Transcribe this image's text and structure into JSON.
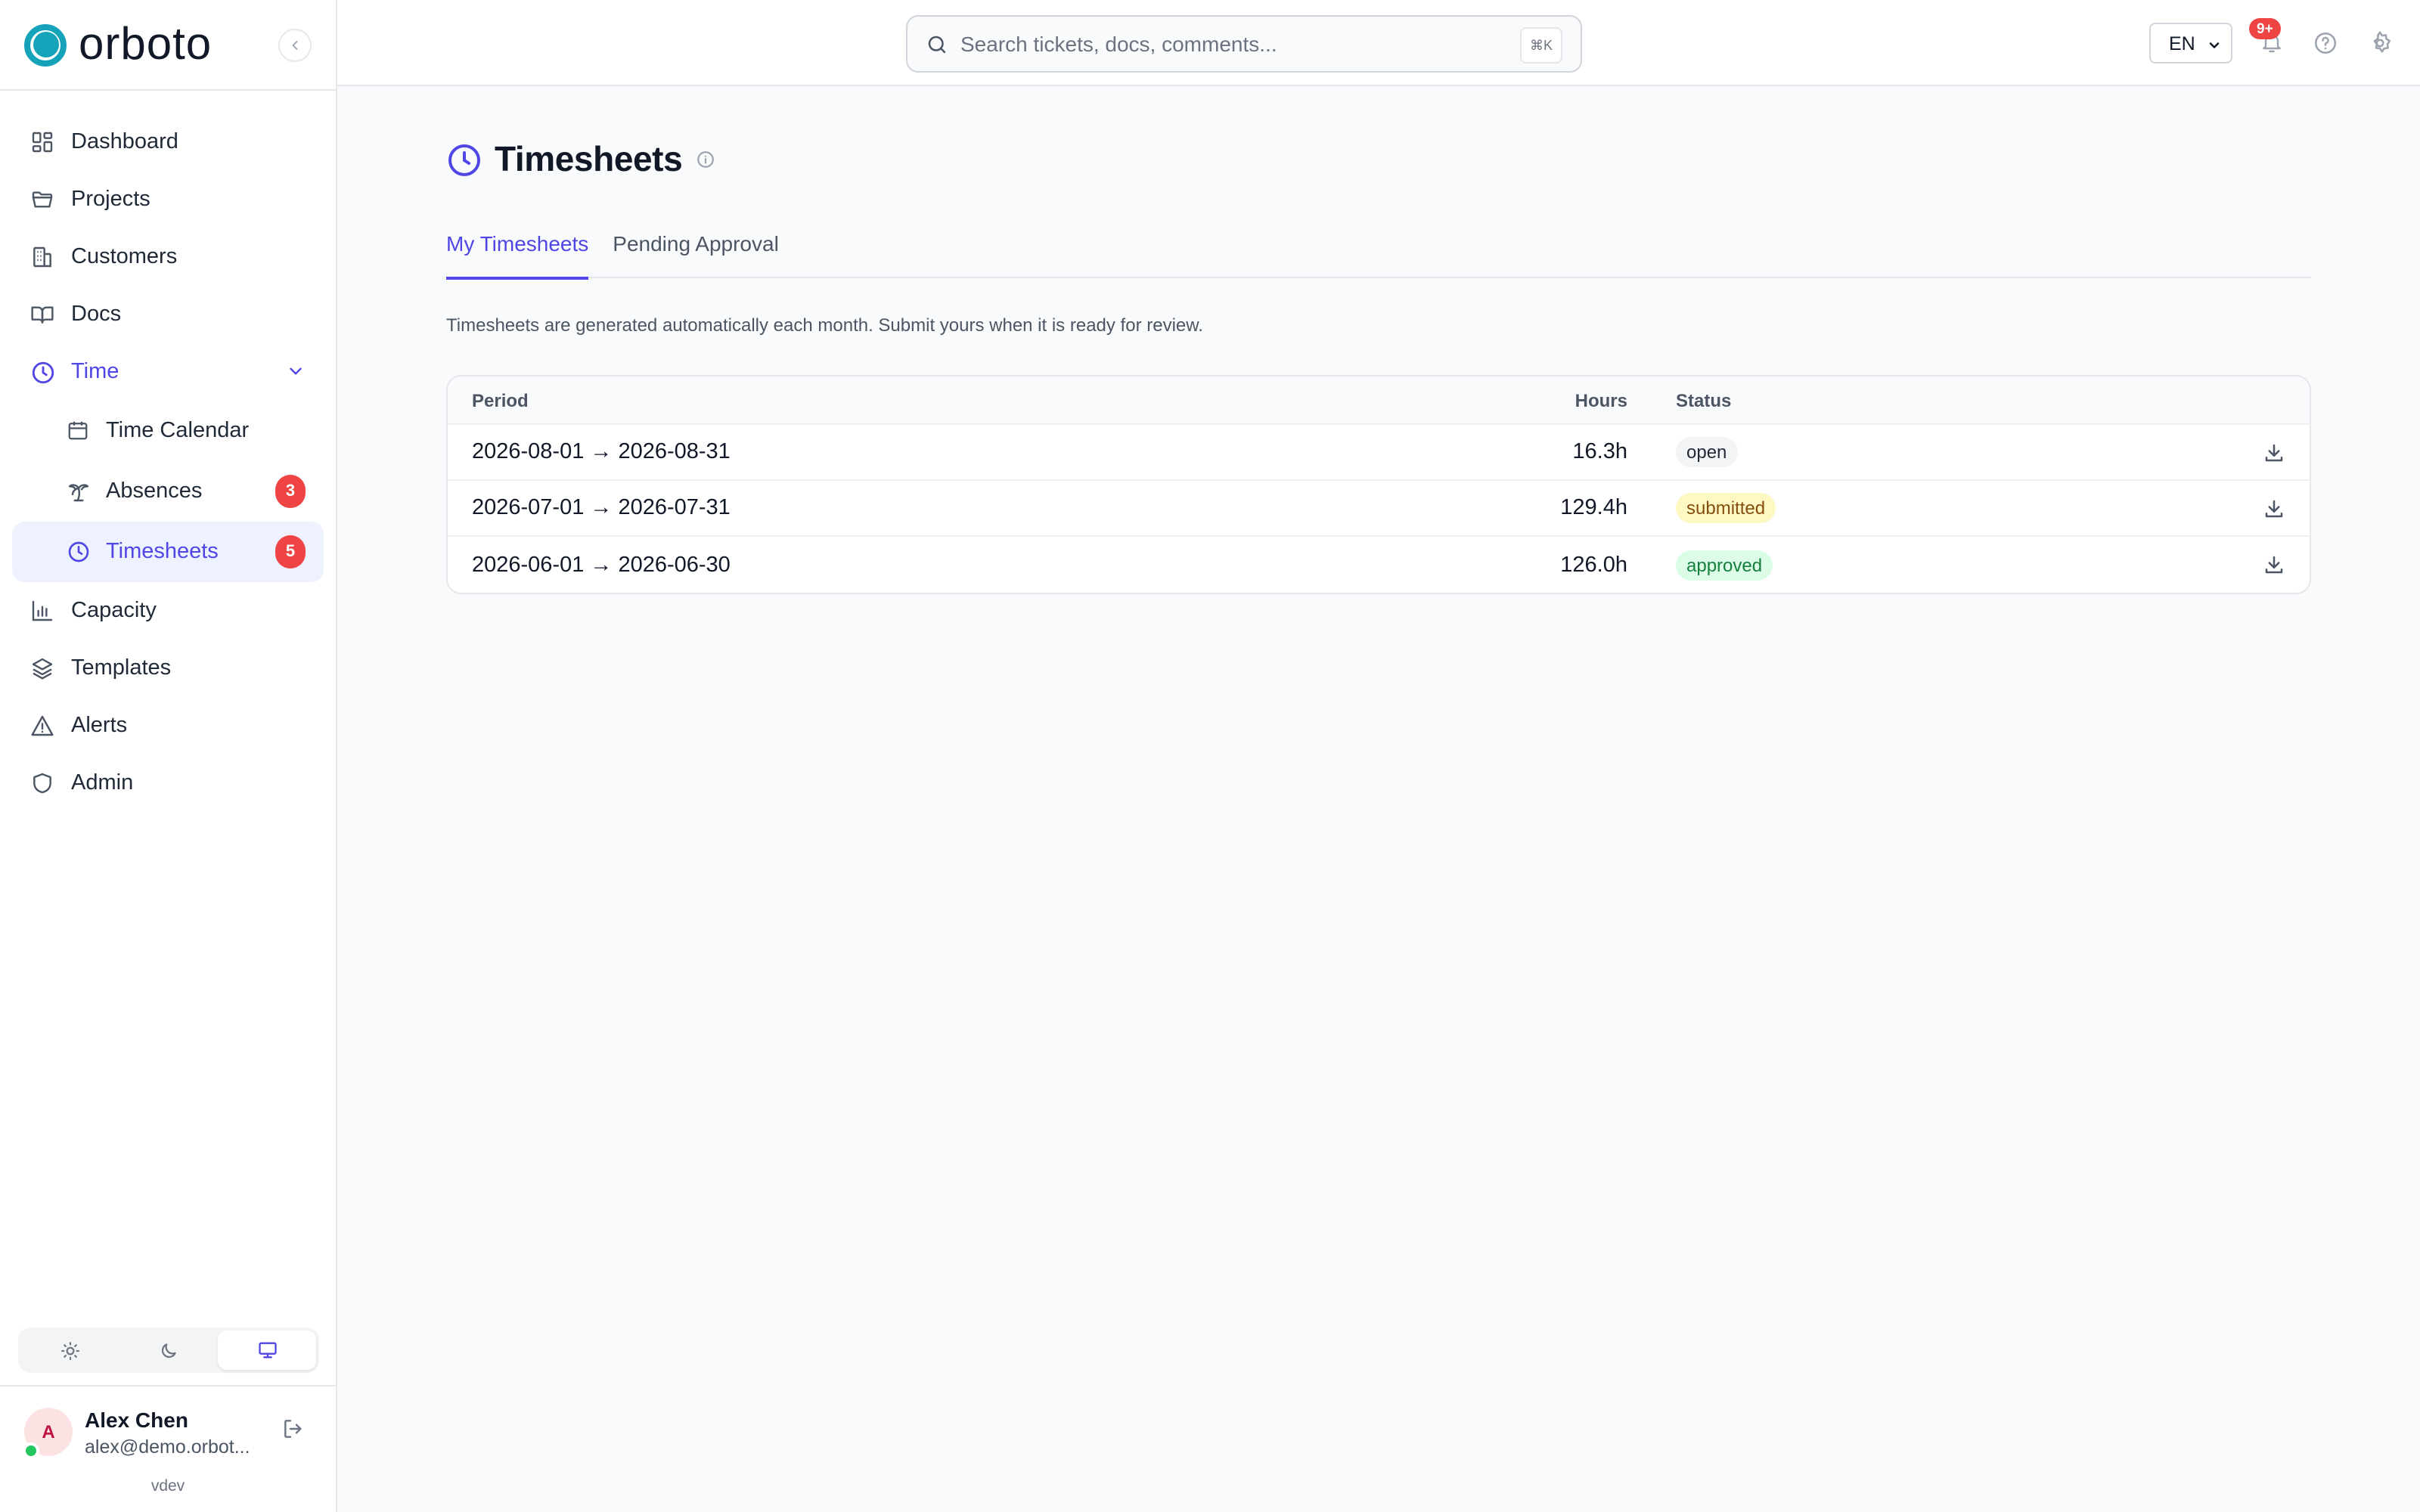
{
  "brand": {
    "name": "orboto",
    "color": "#14a3b8"
  },
  "sidebar": {
    "items": [
      {
        "label": "Dashboard",
        "icon": "dashboard-icon"
      },
      {
        "label": "Projects",
        "icon": "folder-icon"
      },
      {
        "label": "Customers",
        "icon": "building-icon"
      },
      {
        "label": "Docs",
        "icon": "book-icon"
      },
      {
        "label": "Time",
        "icon": "clock-icon",
        "expanded": true
      },
      {
        "label": "Capacity",
        "icon": "bar-chart-icon"
      },
      {
        "label": "Templates",
        "icon": "layers-icon"
      },
      {
        "label": "Alerts",
        "icon": "alert-triangle-icon"
      },
      {
        "label": "Admin",
        "icon": "shield-icon"
      }
    ],
    "time_children": [
      {
        "label": "Time Calendar",
        "icon": "calendar-icon"
      },
      {
        "label": "Absences",
        "icon": "palm-tree-icon",
        "badge": "3"
      },
      {
        "label": "Timesheets",
        "icon": "clock-icon",
        "badge": "5",
        "selected": true
      }
    ],
    "theme_options": [
      "sun-icon",
      "moon-icon",
      "monitor-icon"
    ],
    "theme_selected": "monitor-icon",
    "user": {
      "initial": "A",
      "name": "Alex Chen",
      "email": "alex@demo.orbot...",
      "version": "vdev"
    }
  },
  "topbar": {
    "search_placeholder": "Search tickets, docs, comments...",
    "search_shortcut": "⌘K",
    "language": "EN",
    "notification_count": "9+"
  },
  "page": {
    "title": "Timesheets",
    "tabs": [
      {
        "label": "My Timesheets",
        "active": true
      },
      {
        "label": "Pending Approval",
        "active": false
      }
    ],
    "hint": "Timesheets are generated automatically each month. Submit yours when it is ready for review.",
    "table": {
      "headers": {
        "period": "Period",
        "hours": "Hours",
        "status": "Status"
      },
      "rows": [
        {
          "period": "2026-08-01 → 2026-08-31",
          "hours": "16.3h",
          "status": "open"
        },
        {
          "period": "2026-07-01 → 2026-07-31",
          "hours": "129.4h",
          "status": "submitted"
        },
        {
          "period": "2026-06-01 → 2026-06-30",
          "hours": "126.0h",
          "status": "approved"
        }
      ]
    }
  },
  "colors": {
    "accent": "#4f46e5",
    "badge_red": "#ef4444"
  }
}
